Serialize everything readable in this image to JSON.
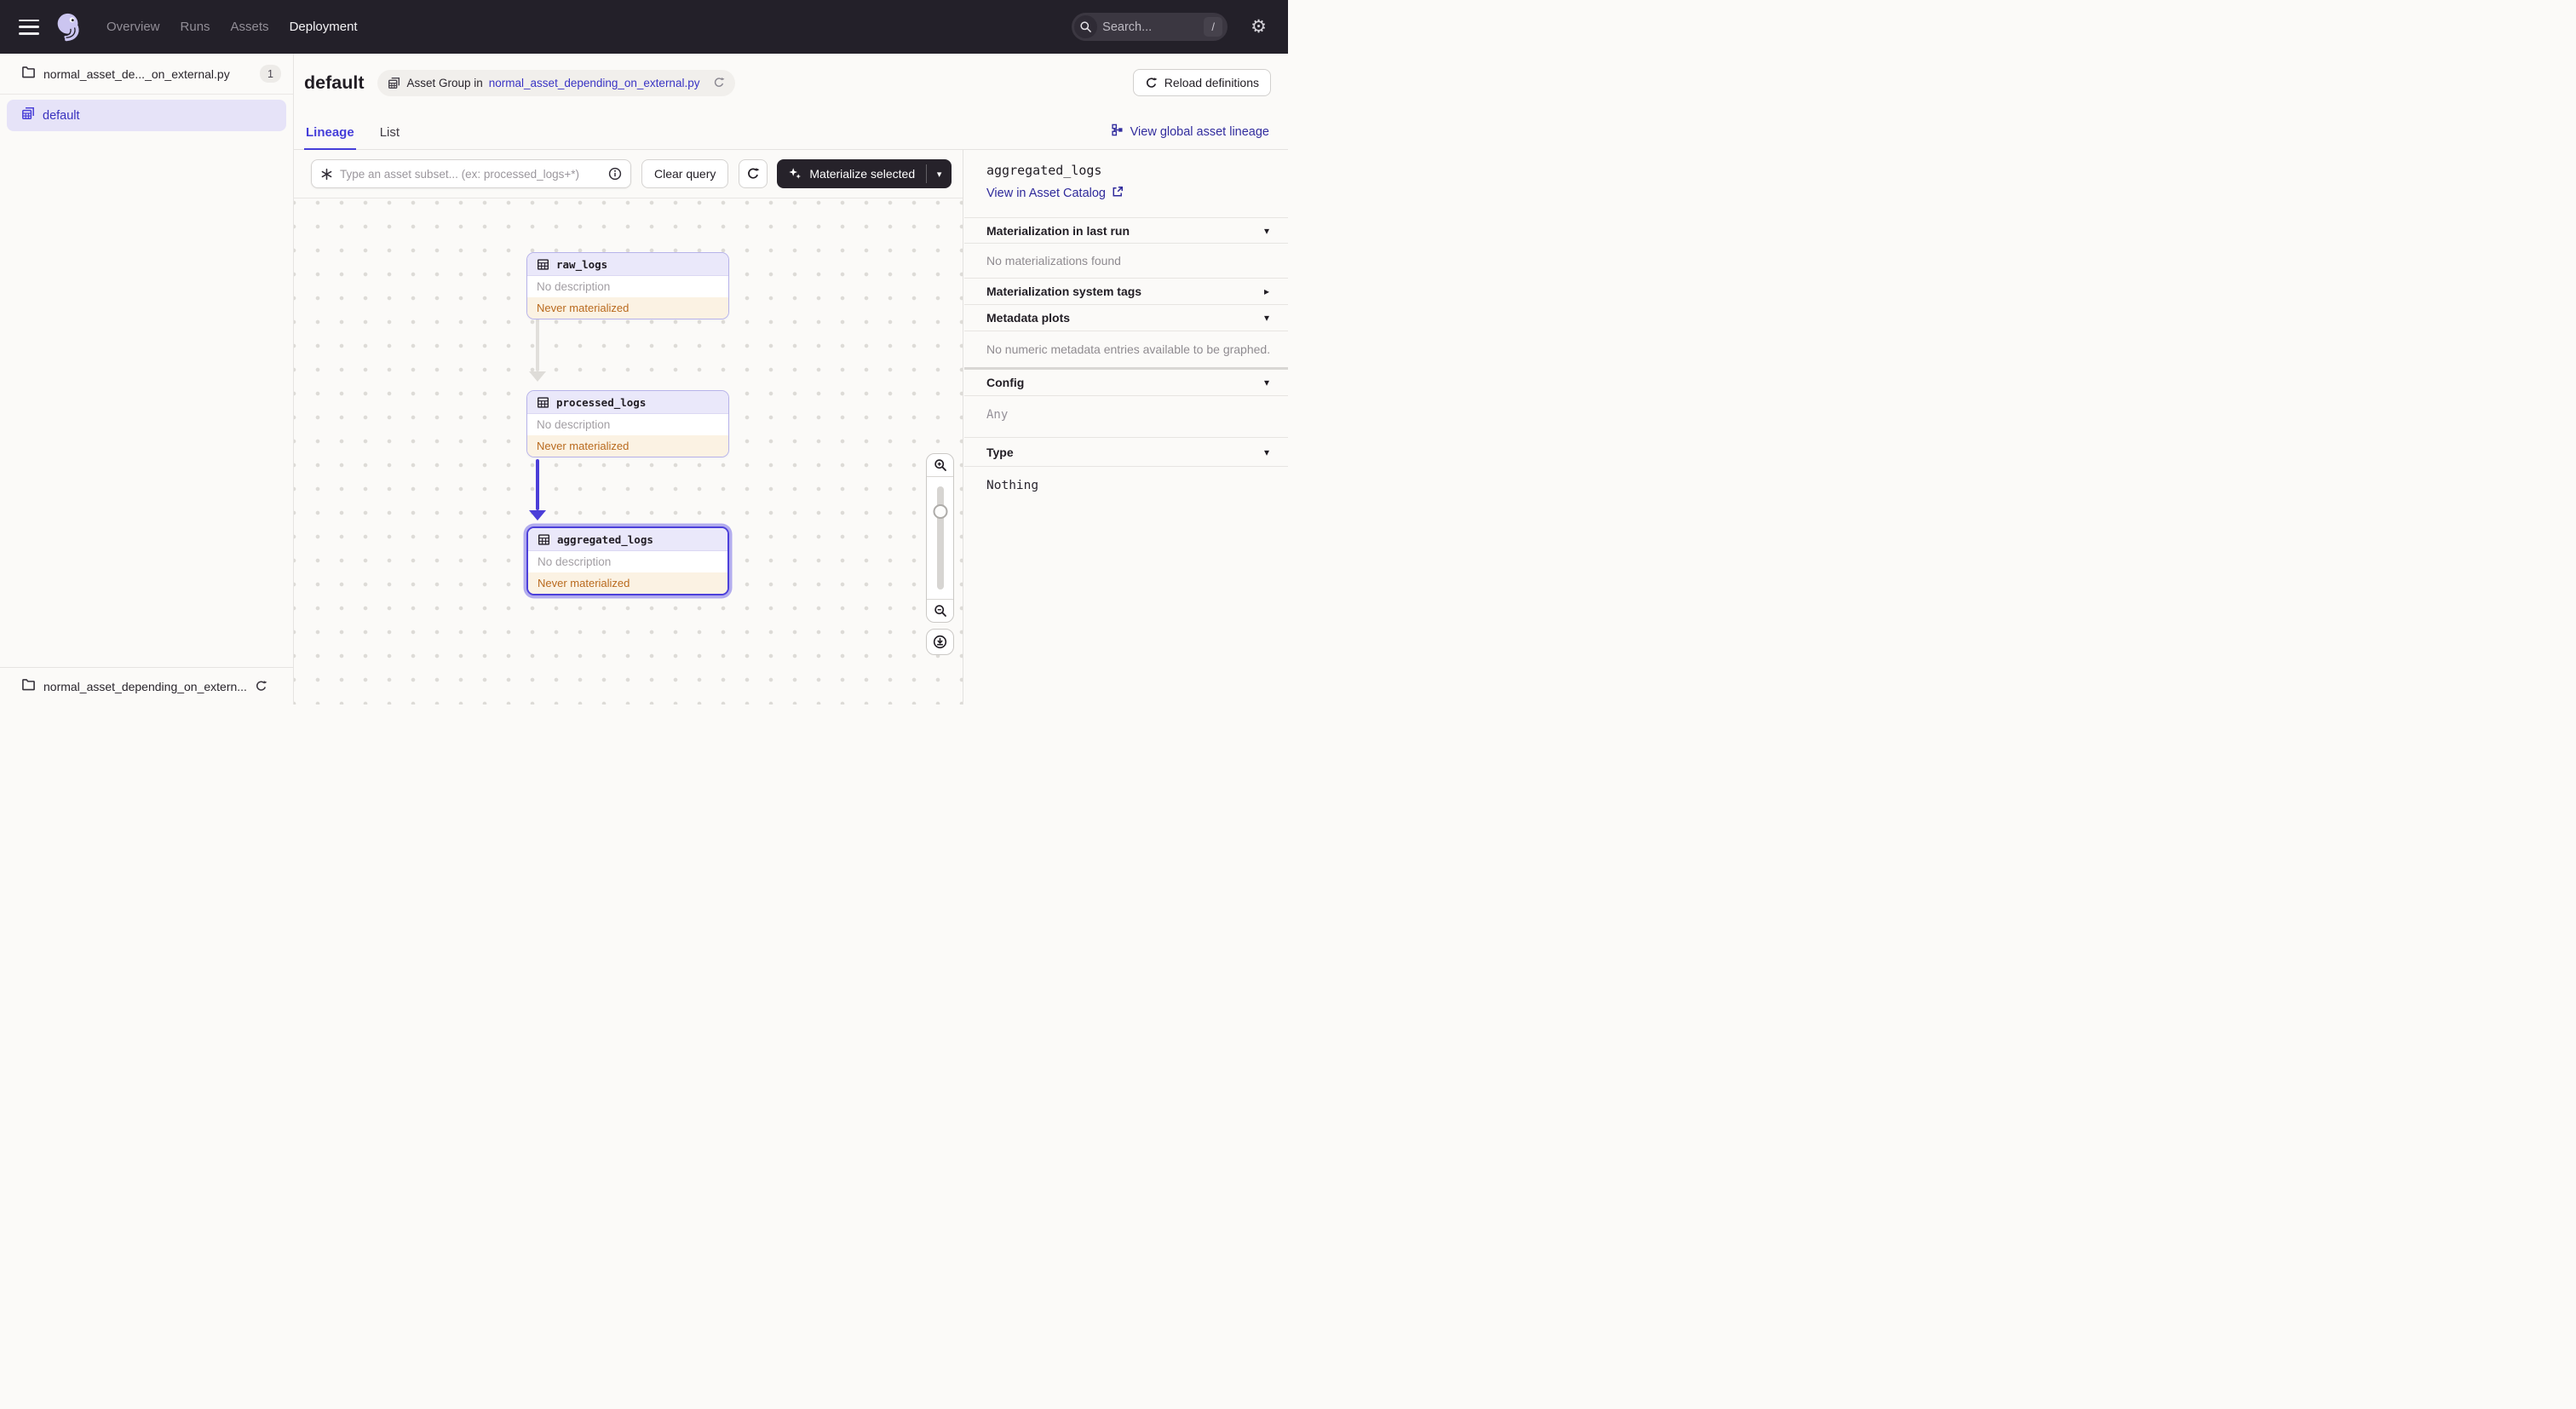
{
  "nav": {
    "links": [
      "Overview",
      "Runs",
      "Assets",
      "Deployment"
    ],
    "active_link": "Deployment",
    "search_placeholder": "Search...",
    "search_shortcut": "/"
  },
  "sidebar": {
    "top_item": {
      "label": "normal_asset_de..._on_external.py",
      "badge": "1"
    },
    "selected_item": {
      "label": "default"
    },
    "bottom_item": {
      "label": "normal_asset_depending_on_extern..."
    }
  },
  "header": {
    "title": "default",
    "group_pill": {
      "prefix": "Asset Group in",
      "link": "normal_asset_depending_on_external.py"
    },
    "reload_button": "Reload definitions"
  },
  "tabs": {
    "lineage": "Lineage",
    "list": "List",
    "global_lineage_link": "View global asset lineage"
  },
  "toolbar": {
    "query_placeholder": "Type an asset subset... (ex: processed_logs+*)",
    "clear_button": "Clear query",
    "materialize_button": "Materialize selected"
  },
  "graph": {
    "nodes": [
      {
        "name": "raw_logs",
        "description": "No description",
        "status": "Never materialized",
        "selected": false
      },
      {
        "name": "processed_logs",
        "description": "No description",
        "status": "Never materialized",
        "selected": false
      },
      {
        "name": "aggregated_logs",
        "description": "No description",
        "status": "Never materialized",
        "selected": true
      }
    ]
  },
  "panel": {
    "title": "aggregated_logs",
    "catalog_link": "View in Asset Catalog",
    "sections": {
      "last_run": {
        "label": "Materialization in last run",
        "empty": "No materializations found"
      },
      "system_tags": {
        "label": "Materialization system tags"
      },
      "metadata_plots": {
        "label": "Metadata plots",
        "empty": "No numeric metadata entries available to be graphed."
      },
      "config": {
        "label": "Config",
        "value": "Any"
      },
      "type": {
        "label": "Type",
        "value": "Nothing"
      }
    }
  },
  "colors": {
    "accent_indigo": "#453ED9",
    "link_navy": "#2F2A9B",
    "node_border": "#B7B3EA",
    "node_selected_border": "#4C40DA",
    "node_header_bg": "#EAE8FA",
    "status_warning_text": "#B96A1E",
    "status_warning_bg": "#FBF2E3",
    "topnav_bg": "#232029"
  }
}
